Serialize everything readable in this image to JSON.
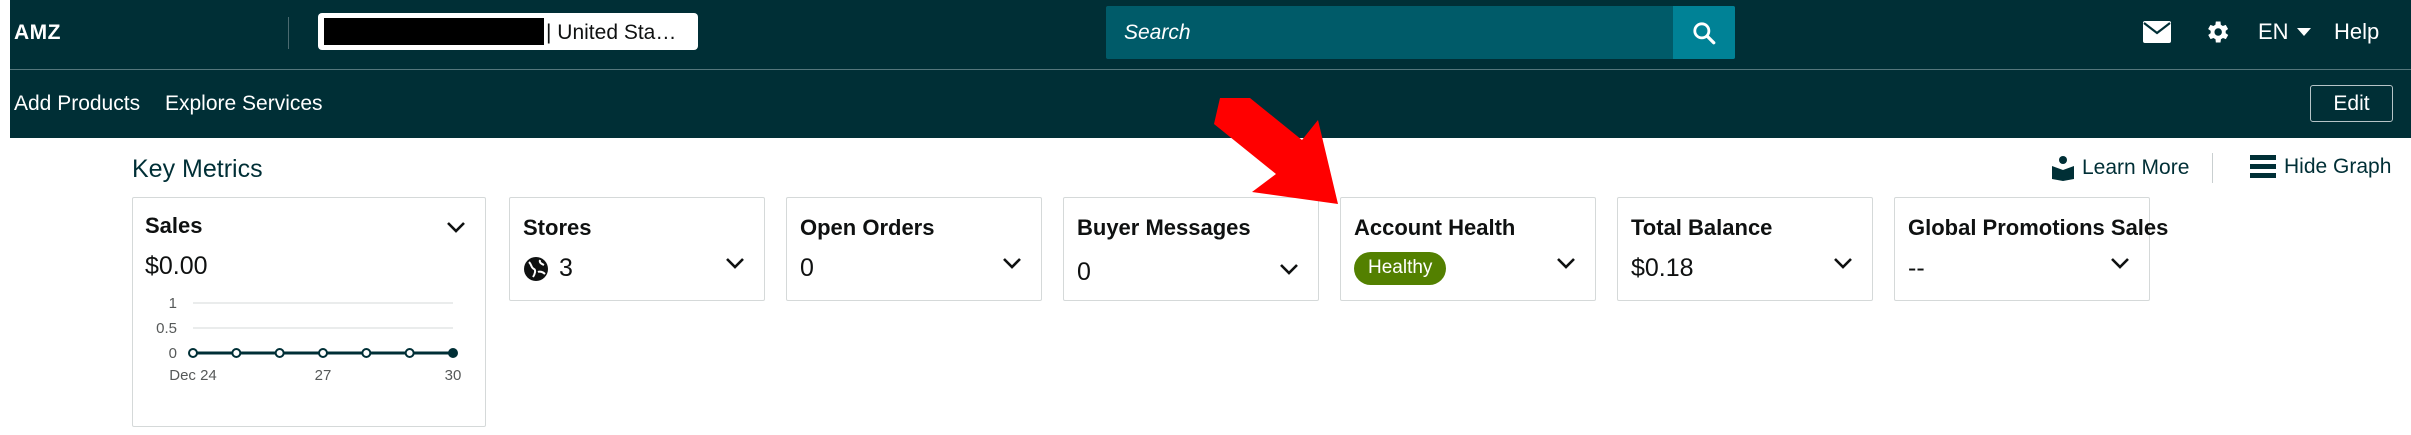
{
  "brand": "AMZ",
  "account_selector": {
    "visible_text": "| United Sta…"
  },
  "search": {
    "placeholder": "Search"
  },
  "header_icons": {
    "mail": "mail-icon",
    "settings": "gear-icon",
    "search": "search-icon"
  },
  "language": "EN",
  "help": "Help",
  "nav": {
    "items": [
      "Add Products",
      "Explore Services"
    ],
    "edit": "Edit"
  },
  "key_metrics": {
    "title": "Key Metrics",
    "learn_more": "Learn More",
    "hide_graph": "Hide Graph"
  },
  "cards": {
    "sales": {
      "title": "Sales",
      "value": "$0.00"
    },
    "stores": {
      "title": "Stores",
      "value": "3",
      "icon": "globe-icon"
    },
    "open_orders": {
      "title": "Open Orders",
      "value": "0"
    },
    "buyer_messages": {
      "title": "Buyer Messages",
      "value": "0"
    },
    "account_health": {
      "title": "Account Health",
      "value": "Healthy",
      "badge_color": "#538000"
    },
    "total_balance": {
      "title": "Total Balance",
      "value": "$0.18"
    },
    "global_promotions": {
      "title": "Global Promotions Sales",
      "value": "--"
    }
  },
  "chart_data": {
    "type": "line",
    "x": [
      "Dec 24",
      "Dec 25",
      "Dec 26",
      "Dec 27",
      "Dec 28",
      "Dec 29",
      "Dec 30"
    ],
    "x_tick_labels": [
      "Dec 24",
      "27",
      "30"
    ],
    "series": [
      {
        "values": [
          0,
          0,
          0,
          0,
          0,
          0,
          0
        ]
      }
    ],
    "y_tick_labels": [
      "1",
      "0.5",
      "0"
    ],
    "ylim": [
      0,
      1
    ],
    "grid": true
  },
  "colors": {
    "header_bg": "#002f36",
    "search_bg": "#005b69",
    "search_button": "#008296",
    "annotation_arrow": "#ff0000"
  }
}
